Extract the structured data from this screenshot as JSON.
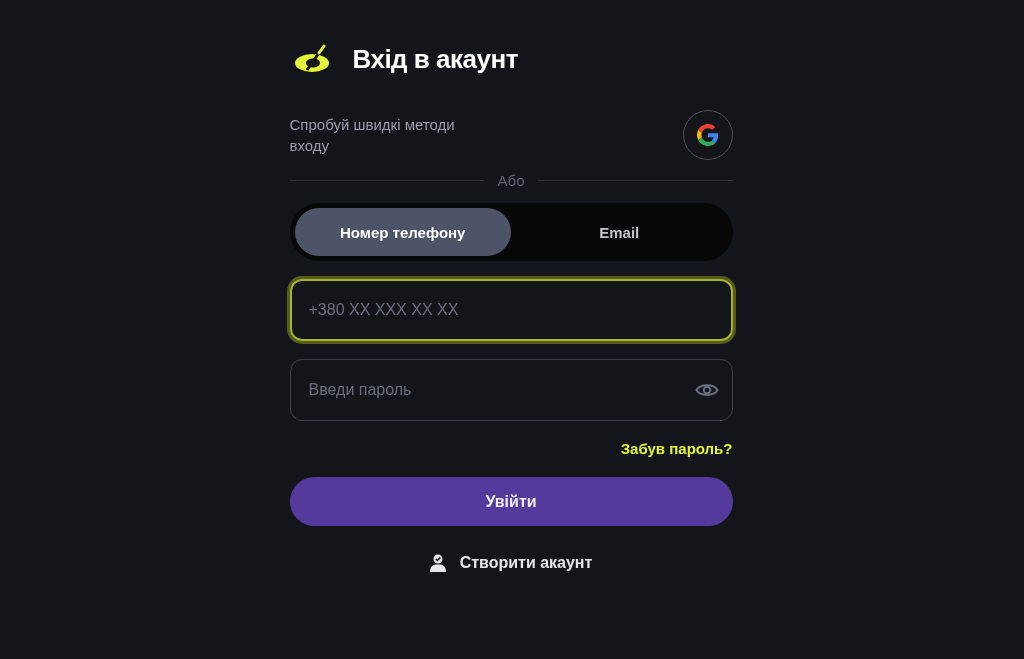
{
  "title": "Вхід в акаунт",
  "quick_login": {
    "text": "Спробуй швидкі методи входу"
  },
  "divider": "Або",
  "tabs": [
    {
      "label": "Номер телефону",
      "selected": true
    },
    {
      "label": "Email",
      "selected": false
    }
  ],
  "phone_field": {
    "placeholder": "+380 XX XXX XX XX",
    "focused": true
  },
  "password_field": {
    "placeholder": "Введи пароль",
    "focused": false
  },
  "forgot_link": "Забув пароль?",
  "submit_button": "Увійти",
  "create_account_link": "Створити акаунт"
}
